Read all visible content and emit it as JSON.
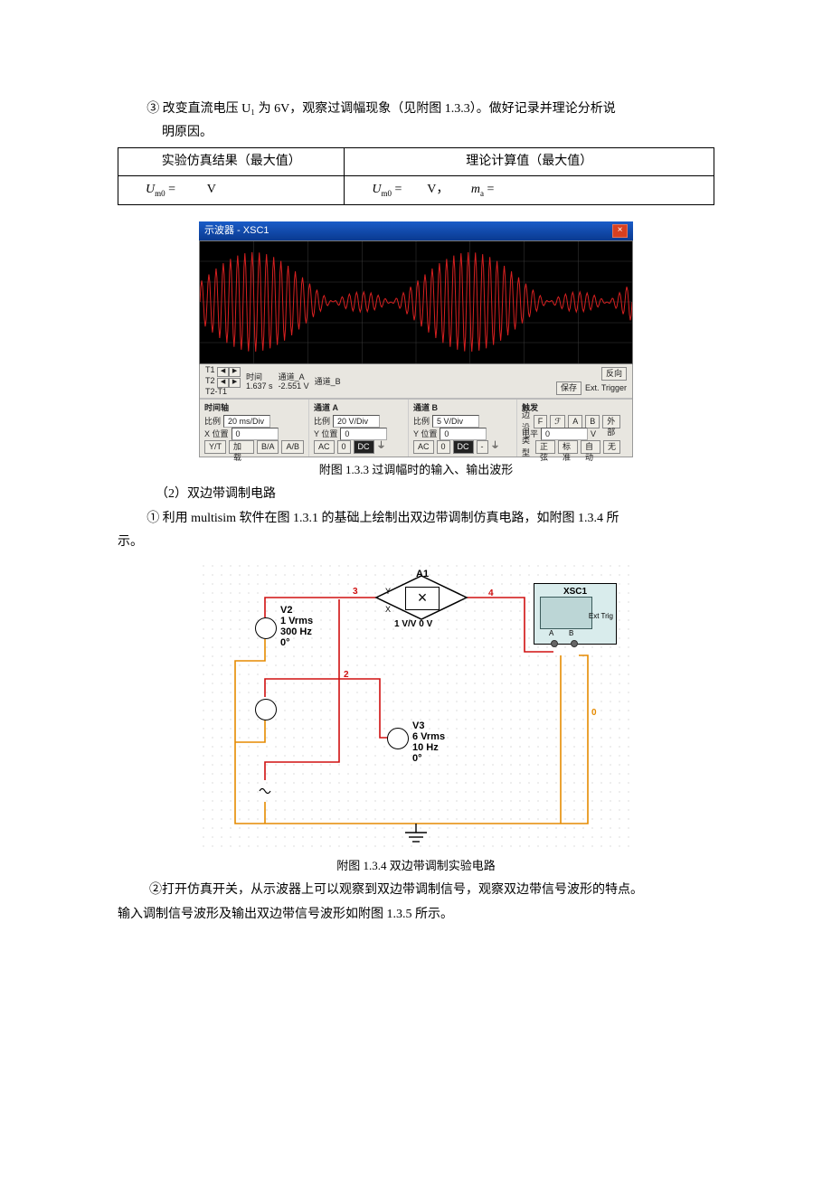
{
  "text": {
    "item3_line1": "③ 改变直流电压 U₁ 为 6V，观察过调幅现象（见附图 1.3.3）。做好记录并理论分析说",
    "item3_line2": "明原因。",
    "caption_133": "附图 1.3.3 过调幅时的输入、输出波形",
    "para2_heading": "（2）双边带调制电路",
    "item1_line1": "① 利用 multisim 软件在图 1.3.1 的基础上绘制出双边带调制仿真电路，如附图 1.3.4 所",
    "item1_line2": "示。",
    "caption_134": "附图 1.3.4  双边带调制实验电路",
    "item2_line1": "②打开仿真开关，从示波器上可以观察到双边带调制信号，观察双边带信号波形的特点。",
    "item2_line2": "输入调制信号波形及输出双边带信号波形如附图 1.3.5 所示。"
  },
  "table": {
    "h1": "实验仿真结果（最大值）",
    "h2": "理论计算值（最大值）",
    "r1c1_sym": "U",
    "r1c1_sub": "m0",
    "r1c1_eq": "=",
    "r1c1_unit": "V",
    "r1c2_sym": "U",
    "r1c2_sub": "m0",
    "r1c2_eq": "=",
    "r1c2_unit": "V，",
    "r1c2_m": "m",
    "r1c2_msub": "a",
    "r1c2_meq": " ="
  },
  "scope": {
    "title": "示波器 - XSC1",
    "t1": "T1",
    "t2": "T2",
    "t2t1": "T2-T1",
    "time_hdr": "时间",
    "chA_hdr": "通道_A",
    "chB_hdr": "通道_B",
    "time_val": "1.637 s",
    "chA_val": "-2.551 V",
    "reverse": "反向",
    "save": "保存",
    "ext_trigger": "Ext. Trigger",
    "timebase": "时间轴",
    "chA": "通道 A",
    "chB": "通道 B",
    "trigger": "触发",
    "scale": "比例",
    "xpos": "X 位置",
    "ypos": "Y 位置",
    "tb_scale": "20 ms/Div",
    "a_scale": "20 V/Div",
    "b_scale": "5 V/Div",
    "zero": "0",
    "yt": "Y/T",
    "add": "加载",
    "ba": "B/A",
    "ab": "A/B",
    "ac": "AC",
    "dc": "DC",
    "edge": "边沿",
    "level": "电平",
    "type": "类型",
    "f": "F",
    "rise": "↧",
    "aBtn": "A",
    "bBtn": "B",
    "ext": "外部",
    "vUnit": "V",
    "sine": "正弦",
    "norm": "标准",
    "auto": "自动",
    "none": "无"
  },
  "circuit": {
    "a1": "A1",
    "mult_sub": "1 V/V 0 V",
    "xsc1": "XSC1",
    "ext_trig": "Ext Trig",
    "portA": "A",
    "portB": "B",
    "v2": "V2",
    "v2_line1": "1 Vrms",
    "v2_line2": "300 Hz",
    "v2_line3": "0°",
    "v3": "V3",
    "v3_line1": "6 Vrms",
    "v3_line2": "10 Hz",
    "v3_line3": "0°",
    "w2": "2",
    "w3": "3",
    "w4": "4",
    "w0": "0"
  }
}
